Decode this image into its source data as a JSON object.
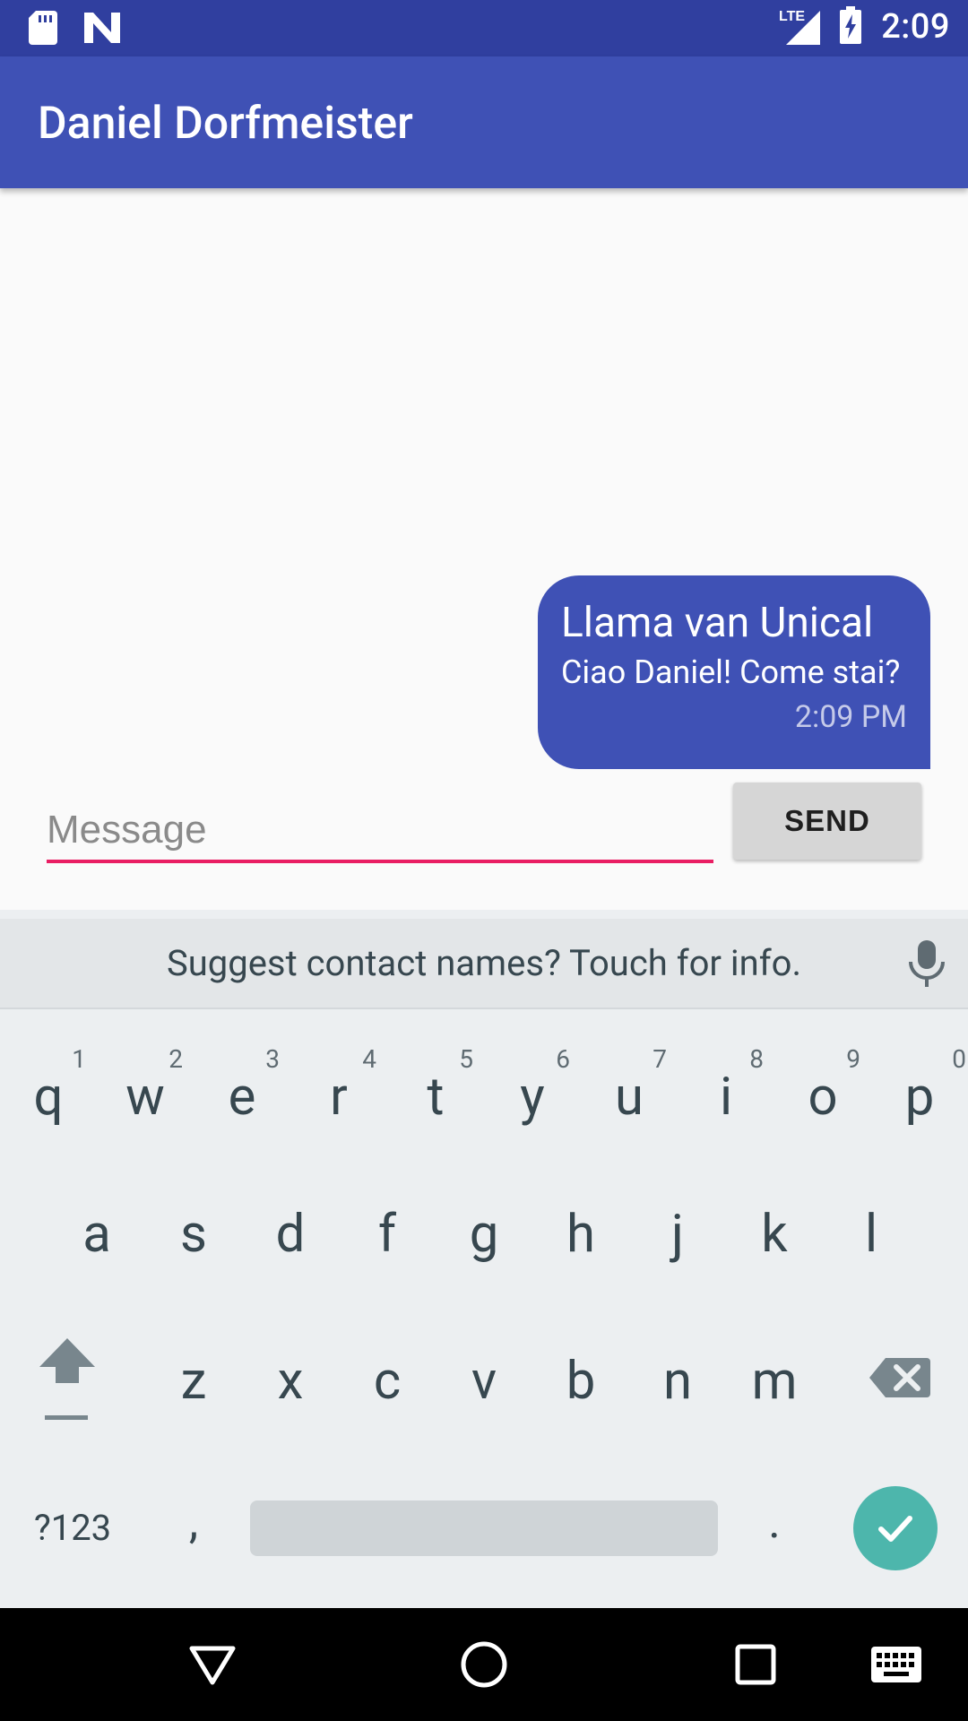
{
  "status_bar": {
    "time": "2:09",
    "network": "LTE",
    "icons": [
      "sd-card-icon",
      "n-logo-icon",
      "lte-signal-icon",
      "battery-charging-icon"
    ]
  },
  "app_bar": {
    "title": "Daniel Dorfmeister"
  },
  "conversation": {
    "messages": [
      {
        "sender": "Llama van Unical",
        "text": "Ciao Daniel! Come stai?",
        "time": "2:09 PM"
      }
    ]
  },
  "composer": {
    "placeholder": "Message",
    "value": "",
    "send_label": "SEND"
  },
  "keyboard": {
    "suggestion": "Suggest contact names? Touch for info.",
    "row1": [
      {
        "key": "q",
        "hint": "1"
      },
      {
        "key": "w",
        "hint": "2"
      },
      {
        "key": "e",
        "hint": "3"
      },
      {
        "key": "r",
        "hint": "4"
      },
      {
        "key": "t",
        "hint": "5"
      },
      {
        "key": "y",
        "hint": "6"
      },
      {
        "key": "u",
        "hint": "7"
      },
      {
        "key": "i",
        "hint": "8"
      },
      {
        "key": "o",
        "hint": "9"
      },
      {
        "key": "p",
        "hint": "0"
      }
    ],
    "row2": [
      "a",
      "s",
      "d",
      "f",
      "g",
      "h",
      "j",
      "k",
      "l"
    ],
    "row3": [
      "z",
      "x",
      "c",
      "v",
      "b",
      "n",
      "m"
    ],
    "symbols_label": "?123",
    "comma_label": ",",
    "period_label": "."
  },
  "colors": {
    "primary": "#3f51b5",
    "primary_dark": "#303f9f",
    "accent": "#e91e63",
    "enter_key": "#4db6ac"
  }
}
